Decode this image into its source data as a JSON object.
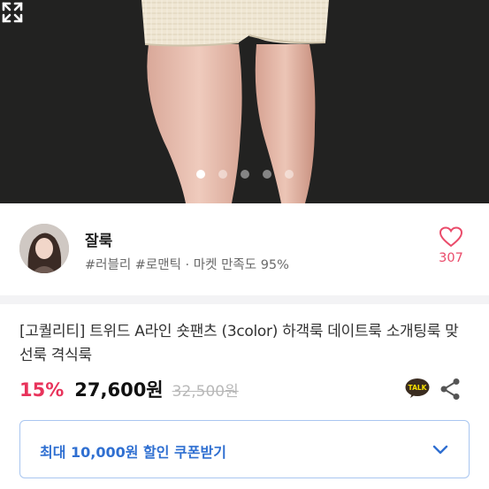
{
  "gallery": {
    "slide_count": 5,
    "active_index": 0,
    "expand_icon": "expand-icon"
  },
  "shop": {
    "name": "잘룩",
    "tags": "#러블리 #로맨틱 · 마켓 만족도 95%",
    "like_icon": "heart-icon",
    "like_count": "307"
  },
  "product": {
    "title": "[고퀄리티] 트위드 A라인 숏팬츠 (3color) 하객룩 데이트룩 소개팅룩 맞선룩 격식룩",
    "discount": "15%",
    "price": "27,600원",
    "original_price": "32,500원",
    "talk_badge": "TALK",
    "share_icon": "share-icon"
  },
  "coupon": {
    "label": "최대 10,000원 할인 쿠폰받기",
    "chevron_icon": "chevron-down-icon"
  },
  "colors": {
    "accent_pink": "#e8335b",
    "coupon_blue": "#2f6fd1",
    "talk_yellow": "#f9e000"
  }
}
